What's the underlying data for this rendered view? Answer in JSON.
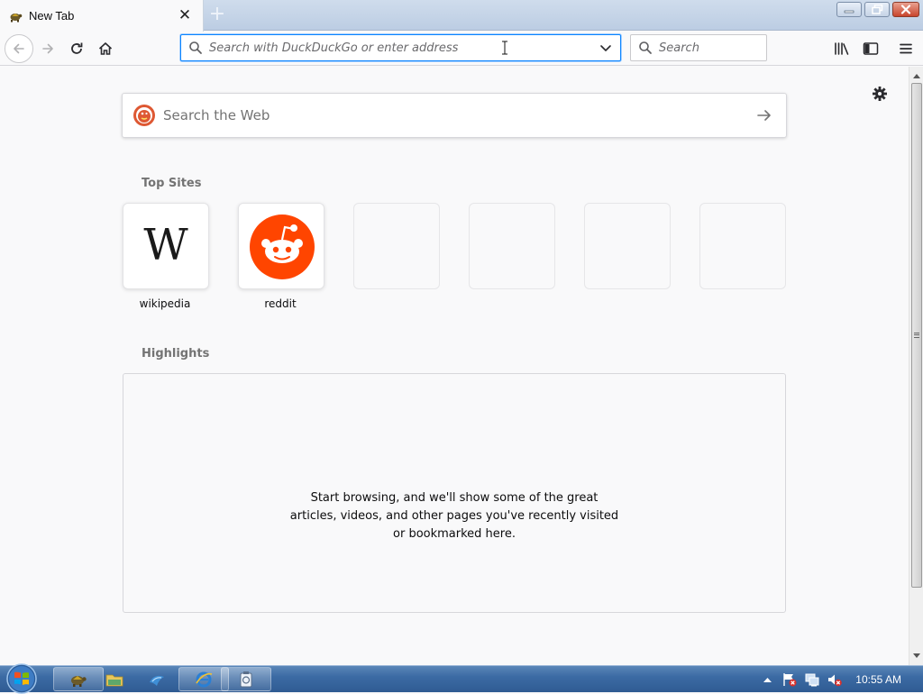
{
  "browser": {
    "tab": {
      "title": "New Tab",
      "favicon": "turtle-icon"
    },
    "new_tab_label": "+",
    "close_tab_symbol": "✕",
    "urlbar": {
      "placeholder": "Search with DuckDuckGo or enter address",
      "value": ""
    },
    "searchbar": {
      "placeholder": "Search",
      "value": ""
    },
    "accent": "#0a84ff"
  },
  "newtab": {
    "web_search": {
      "placeholder": "Search the Web",
      "engine_icon": "duckduckgo-icon"
    },
    "top_sites": {
      "title": "Top Sites",
      "sites": [
        {
          "label": "wikipedia",
          "icon": "wikipedia-w"
        },
        {
          "label": "reddit",
          "icon": "reddit-alien",
          "color": "#ff4500"
        },
        {
          "label": ""
        },
        {
          "label": ""
        },
        {
          "label": ""
        },
        {
          "label": ""
        }
      ]
    },
    "highlights": {
      "title": "Highlights",
      "empty_message": "Start browsing, and we'll show some of the great articles, videos, and other pages you've recently visited or bookmarked here."
    }
  },
  "taskbar": {
    "clock": "10:55 AM",
    "apps": [
      "turtle-browser-icon",
      "file-explorer-icon",
      "media-player-icon",
      "internet-explorer-icon",
      "utility-icon"
    ]
  }
}
